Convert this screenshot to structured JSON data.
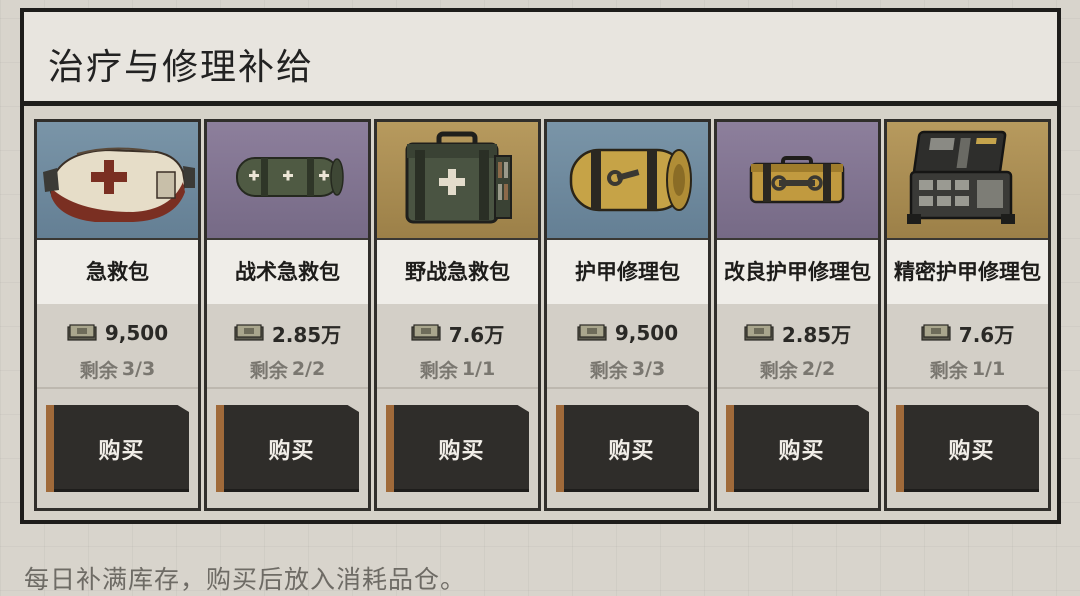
{
  "panel": {
    "title": "治疗与修理补给"
  },
  "items": [
    {
      "name": "急救包",
      "price": "9,500",
      "remaining_label": "剩余",
      "remaining": "3/3",
      "buy_label": "购买",
      "bg": "blue",
      "icon": "first-aid-pouch-icon"
    },
    {
      "name": "战术急救包",
      "price": "2.85万",
      "remaining_label": "剩余",
      "remaining": "2/2",
      "buy_label": "购买",
      "bg": "purple",
      "icon": "tactical-medkit-roll-icon"
    },
    {
      "name": "野战急救包",
      "price": "7.6万",
      "remaining_label": "剩余",
      "remaining": "1/1",
      "buy_label": "购买",
      "bg": "gold",
      "icon": "field-medkit-case-icon"
    },
    {
      "name": "护甲修理包",
      "price": "9,500",
      "remaining_label": "剩余",
      "remaining": "3/3",
      "buy_label": "购买",
      "bg": "blue",
      "icon": "armor-repair-roll-icon"
    },
    {
      "name": "改良护甲修理包",
      "price": "2.85万",
      "remaining_label": "剩余",
      "remaining": "2/2",
      "buy_label": "购买",
      "bg": "purple",
      "icon": "improved-repair-case-icon"
    },
    {
      "name": "精密护甲修理包",
      "price": "7.6万",
      "remaining_label": "剩余",
      "remaining": "1/1",
      "buy_label": "购买",
      "bg": "gold",
      "icon": "precision-repair-kit-icon"
    }
  ],
  "footer": {
    "note": "每日补满库存，购买后放入消耗品仓。"
  },
  "colors": {
    "blue_bg": "#6f8a9e",
    "purple_bg": "#857895",
    "gold_bg": "#ad8f55",
    "button": "#2f2d2a",
    "button_accent": "#a06a3a"
  }
}
